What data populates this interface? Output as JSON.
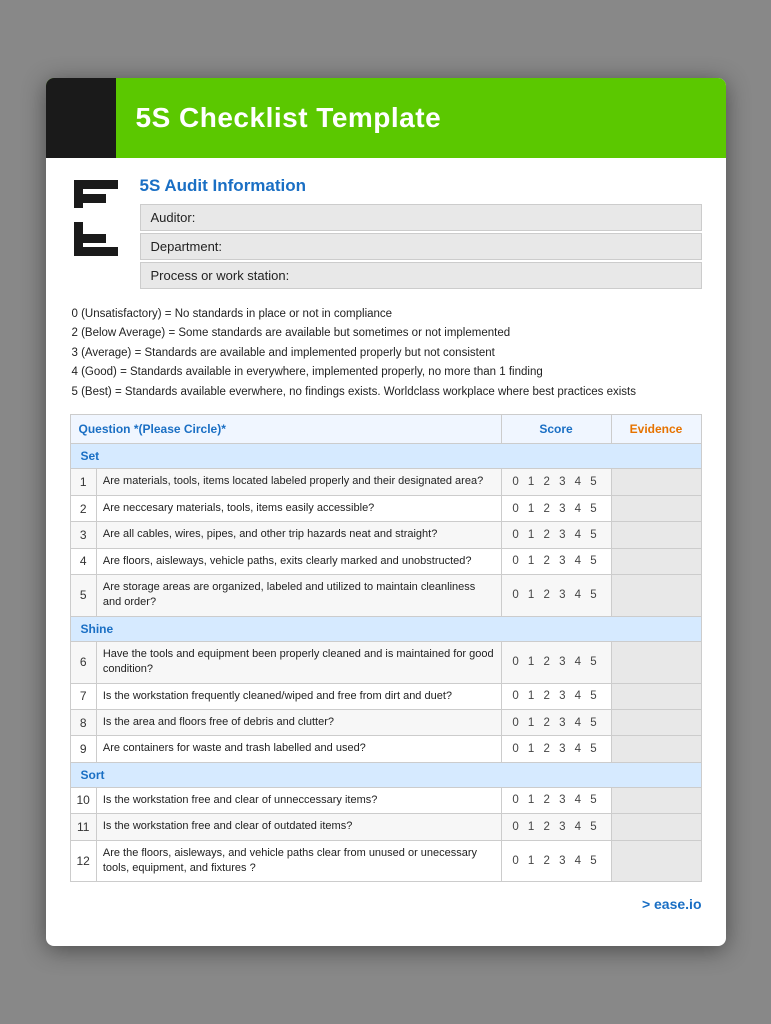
{
  "header": {
    "title": "5S Checklist Template",
    "bg_color": "#5bc800"
  },
  "audit_info": {
    "heading": "5S Audit Information",
    "fields": [
      "Auditor:",
      "Department:",
      "Process or work station:"
    ]
  },
  "legend": {
    "items": [
      "0 (Unsatisfactory) = No standards in place or not in compliance",
      "2 (Below Average) = Some standards are available but sometimes or not implemented",
      "3 (Average) = Standards are available and implemented properly but not consistent",
      "4 (Good) = Standards available in everywhere, implemented properly, no more than 1 finding",
      "5 (Best) = Standards available everwhere, no findings exists.  Worldclass workplace where best practices exists"
    ]
  },
  "table": {
    "headers": {
      "question": "Question *(Please Circle)*",
      "score": "Score",
      "evidence": "Evidence"
    },
    "score_options": "0  1  2  3  4  5",
    "categories": [
      {
        "name": "Set",
        "rows": [
          {
            "num": 1,
            "question": "Are materials, tools, items located labeled properly and their designated area?"
          },
          {
            "num": 2,
            "question": "Are neccesary materials, tools, items easily accessible?"
          },
          {
            "num": 3,
            "question": "Are all cables, wires, pipes, and other trip hazards neat and straight?"
          },
          {
            "num": 4,
            "question": "Are floors, aisleways, vehicle paths, exits clearly marked and unobstructed?"
          },
          {
            "num": 5,
            "question": "Are storage areas are organized, labeled and utilized to maintain cleanliness and order?"
          }
        ]
      },
      {
        "name": "Shine",
        "rows": [
          {
            "num": 6,
            "question": "Have the tools and equipment been properly cleaned and is maintained for good condition?"
          },
          {
            "num": 7,
            "question": "Is the workstation frequently cleaned/wiped and free from dirt and duet?"
          },
          {
            "num": 8,
            "question": "Is the area and floors free of debris and clutter?"
          },
          {
            "num": 9,
            "question": "Are containers for waste and trash labelled and used?"
          }
        ]
      },
      {
        "name": "Sort",
        "rows": [
          {
            "num": 10,
            "question": "Is the workstation free and clear of unneccessary items?"
          },
          {
            "num": 11,
            "question": "Is the workstation free and clear of outdated items?"
          },
          {
            "num": 12,
            "question": "Are the floors, aisleways, and vehicle paths clear from unused or unecessary tools, equipment, and fixtures ?"
          }
        ]
      }
    ]
  },
  "footer": {
    "link_text": "> ease.io"
  }
}
